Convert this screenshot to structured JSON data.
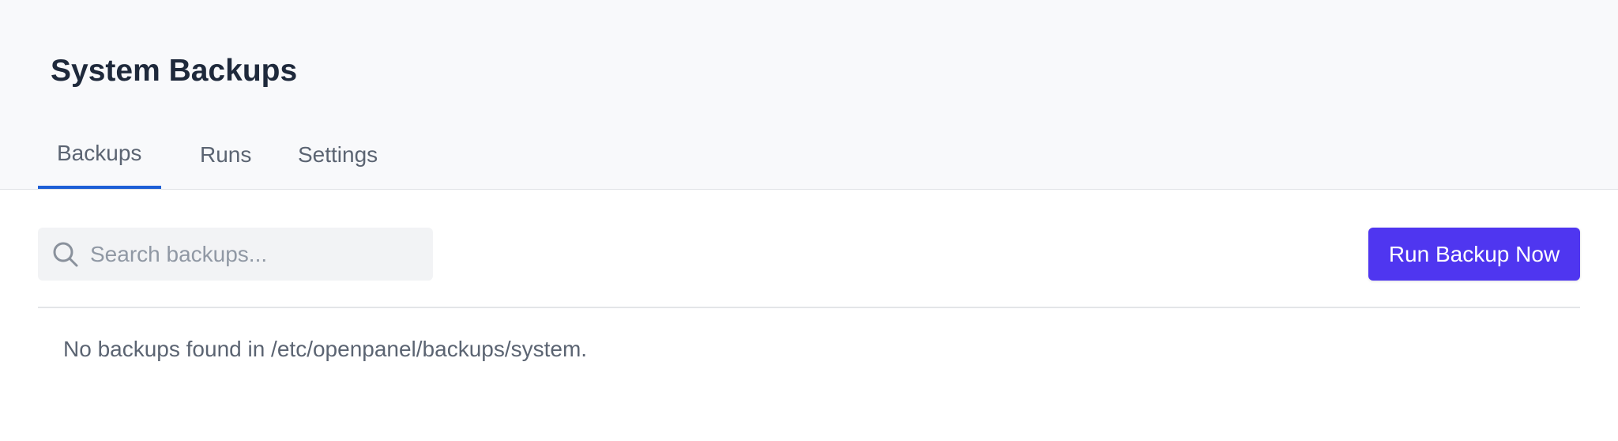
{
  "header": {
    "title": "System Backups"
  },
  "tabs": [
    {
      "label": "Backups",
      "active": true
    },
    {
      "label": "Runs",
      "active": false
    },
    {
      "label": "Settings",
      "active": false
    }
  ],
  "toolbar": {
    "search_placeholder": "Search backups...",
    "search_value": "",
    "search_icon": "search-icon",
    "run_button_label": "Run Backup Now"
  },
  "content": {
    "empty_message": "No backups found in /etc/openpanel/backups/system."
  },
  "colors": {
    "accent": "#1d5fd6",
    "primary_button": "#4f36f0",
    "header_bg": "#f8f9fb",
    "title_text": "#1e293b",
    "muted_text": "#5b6472"
  }
}
